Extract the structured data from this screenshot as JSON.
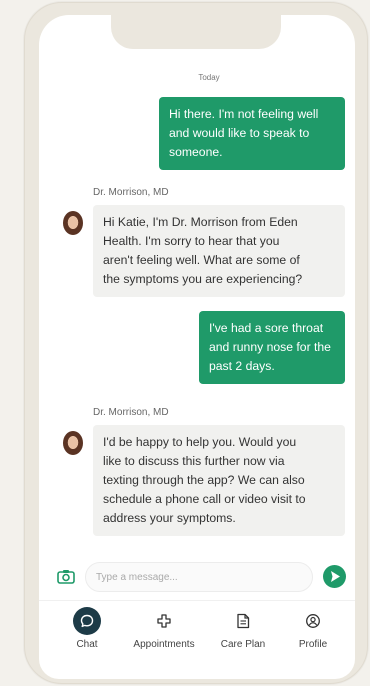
{
  "chat": {
    "date_label": "Today",
    "messages": [
      {
        "direction": "outgoing",
        "lines": [
          "Hi there. I'm not feeling well",
          "and would like to speak to",
          "someone."
        ]
      },
      {
        "direction": "incoming",
        "sender": "Dr. Morrison, MD",
        "lines": [
          "Hi Katie, I'm Dr. Morrison from Eden",
          "Health. I'm sorry to hear that you",
          "aren't feeling well. What are some of",
          "the symptoms you are experiencing?"
        ]
      },
      {
        "direction": "outgoing",
        "lines": [
          "I've had a sore throat",
          "and runny nose for the",
          "past 2 days."
        ]
      },
      {
        "direction": "incoming",
        "sender": "Dr. Morrison, MD",
        "lines": [
          "I'd be happy to help you. Would you",
          "like to discuss this further now via",
          "texting through the app? We can also",
          "schedule a phone call or video visit to",
          "address your symptoms."
        ]
      }
    ]
  },
  "composer": {
    "placeholder": "Type a message...",
    "camera_icon": "camera-icon",
    "send_icon": "send-arrow-icon"
  },
  "nav": {
    "items": [
      {
        "label": "Chat",
        "icon": "chat-bubble-icon",
        "active": true
      },
      {
        "label": "Appointments",
        "icon": "medical-cross-icon",
        "active": false
      },
      {
        "label": "Care Plan",
        "icon": "document-icon",
        "active": false
      },
      {
        "label": "Profile",
        "icon": "profile-icon",
        "active": false
      }
    ]
  },
  "colors": {
    "accent": "#1f9a69",
    "nav_active": "#1d3b47",
    "incoming_bubble": "#f1f1ef",
    "background": "#f3f1ec"
  }
}
